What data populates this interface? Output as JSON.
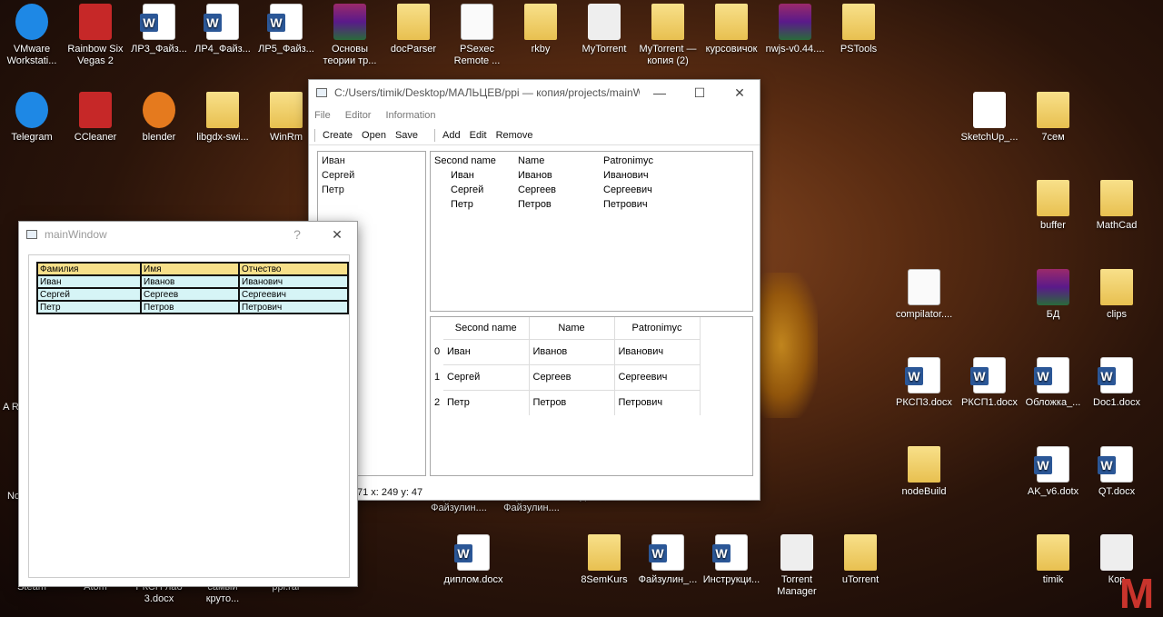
{
  "desktop": {
    "icons": [
      {
        "label": "VMware Workstati...",
        "kind": "blue"
      },
      {
        "label": "Rainbow Six Vegas 2",
        "kind": "red"
      },
      {
        "label": "ЛР3_Файз...",
        "kind": "word"
      },
      {
        "label": "ЛР4_Файз...",
        "kind": "word"
      },
      {
        "label": "ЛР5_Файз...",
        "kind": "word"
      },
      {
        "label": "Основы теории тр...",
        "kind": "rar"
      },
      {
        "label": "docParser",
        "kind": "folder"
      },
      {
        "label": "PSexec Remote ...",
        "kind": "doc"
      },
      {
        "label": "rkby",
        "kind": "folder"
      },
      {
        "label": "MyTorrent",
        "kind": "white"
      },
      {
        "label": "MyTorrent — копия (2)",
        "kind": "folder"
      },
      {
        "label": "курсовичок",
        "kind": "folder"
      },
      {
        "label": "nwjs-v0.44....",
        "kind": "rar"
      },
      {
        "label": "PSTools",
        "kind": "folder"
      },
      {
        "label": "Telegram",
        "kind": "blue"
      },
      {
        "label": "CCleaner",
        "kind": "red"
      },
      {
        "label": "blender",
        "kind": "orange"
      },
      {
        "label": "libgdx-swi...",
        "kind": "folder"
      },
      {
        "label": "WinRm",
        "kind": "folder"
      },
      {
        "label": "SketchUp_...",
        "kind": "green"
      },
      {
        "label": "7сем",
        "kind": "folder"
      },
      {
        "label": "buffer",
        "kind": "folder"
      },
      {
        "label": "MathCad",
        "kind": "folder"
      },
      {
        "label": "compilator....",
        "kind": "doc"
      },
      {
        "label": "БД",
        "kind": "rar"
      },
      {
        "label": "clips",
        "kind": "folder"
      },
      {
        "label": "РКСП3.docx",
        "kind": "word"
      },
      {
        "label": "РКСП1.docx",
        "kind": "word"
      },
      {
        "label": "Обложка_...",
        "kind": "word"
      },
      {
        "label": "Doc1.docx",
        "kind": "word"
      },
      {
        "label": "nodeBuild",
        "kind": "folder"
      },
      {
        "label": "AK_v6.dotx",
        "kind": "word"
      },
      {
        "label": "QT.docx",
        "kind": "word"
      },
      {
        "label": "диплом.docx",
        "kind": "word"
      },
      {
        "label": "8SemKurs",
        "kind": "folder"
      },
      {
        "label": "Файзулин_...",
        "kind": "word"
      },
      {
        "label": "Инструкци...",
        "kind": "word"
      },
      {
        "label": "Torrent Manager",
        "kind": "white"
      },
      {
        "label": "uTorrent",
        "kind": "folder"
      },
      {
        "label": "timik",
        "kind": "folder"
      },
      {
        "label": "Кор",
        "kind": "white"
      },
      {
        "label": "Курсовая Файзулин....",
        "kind": "none"
      },
      {
        "label": "Курсовая Файзулин....",
        "kind": "none"
      },
      {
        "label": "Курсовая",
        "kind": "none"
      },
      {
        "label": "Steam",
        "kind": "none"
      },
      {
        "label": "Atom",
        "kind": "none"
      },
      {
        "label": "РКСП лаб 3.docx",
        "kind": "none"
      },
      {
        "label": "самый круто...",
        "kind": "none"
      },
      {
        "label": "ppi.rar",
        "kind": "none"
      },
      {
        "label": "A Re",
        "kind": "none"
      },
      {
        "label": "No",
        "kind": "none"
      }
    ],
    "partial_icon_labels": [
      "W",
      "Ne"
    ]
  },
  "main_window": {
    "title": "C:/Users/timik/Desktop/МАЛЬЦЕВ/ppi — копия/projects/mainWi...",
    "controls": {
      "minimize": "—",
      "maximize": "☐",
      "close": "✕"
    },
    "menu": [
      "File",
      "Editor",
      "Information"
    ],
    "toolbar_left": [
      "Create",
      "Open",
      "Save"
    ],
    "toolbar_right": [
      "Add",
      "Edit",
      "Remove"
    ],
    "list": [
      "Иван",
      "Сергей",
      "Петр"
    ],
    "tree": {
      "headers": [
        "Second name",
        "Name",
        "Patronimyc"
      ],
      "rows": [
        [
          "Иван",
          "Иванов",
          "Иванович"
        ],
        [
          "Сергей",
          "Сергеев",
          "Сергеевич"
        ],
        [
          "Петр",
          "Петров",
          "Петрович"
        ]
      ]
    },
    "table": {
      "headers": [
        "Second name",
        "Name",
        "Patronimyc"
      ],
      "row_index": [
        "0",
        "1",
        "2"
      ],
      "rows": [
        [
          "Иван",
          "Иванов",
          "Иванович"
        ],
        [
          "Сергей",
          "Сергеев",
          "Сергеевич"
        ],
        [
          "Петр",
          "Петров",
          "Петрович"
        ]
      ]
    },
    "status": "71 x: 249 y: 47"
  },
  "dialog": {
    "title": "mainWindow",
    "help": "?",
    "close": "✕",
    "table": {
      "headers": [
        "Фамилия",
        "Имя",
        "Отчество"
      ],
      "rows": [
        [
          "Иван",
          "Иванов",
          "Иванович"
        ],
        [
          "Сергей",
          "Сергеев",
          "Сергеевич"
        ],
        [
          "Петр",
          "Петров",
          "Петрович"
        ]
      ]
    }
  },
  "corner_logo": "M"
}
